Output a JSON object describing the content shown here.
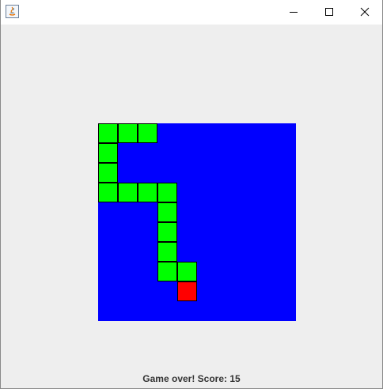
{
  "window": {
    "icon": "java-icon",
    "controls": {
      "minimize_icon": "minimize-icon",
      "maximize_icon": "maximize-icon",
      "close_icon": "close-icon"
    }
  },
  "game": {
    "grid_cells": 10,
    "colors": {
      "background": "#0000ff",
      "snake": "#00ff00",
      "food": "#ff0000",
      "cell_outline": "#000000"
    },
    "snake": [
      [
        0,
        0
      ],
      [
        1,
        0
      ],
      [
        2,
        0
      ],
      [
        0,
        1
      ],
      [
        0,
        2
      ],
      [
        0,
        3
      ],
      [
        1,
        3
      ],
      [
        2,
        3
      ],
      [
        3,
        3
      ],
      [
        3,
        4
      ],
      [
        3,
        5
      ],
      [
        3,
        6
      ],
      [
        3,
        7
      ],
      [
        4,
        7
      ]
    ],
    "food": [
      4,
      8
    ]
  },
  "status": {
    "text": "Game over! Score: 15"
  }
}
